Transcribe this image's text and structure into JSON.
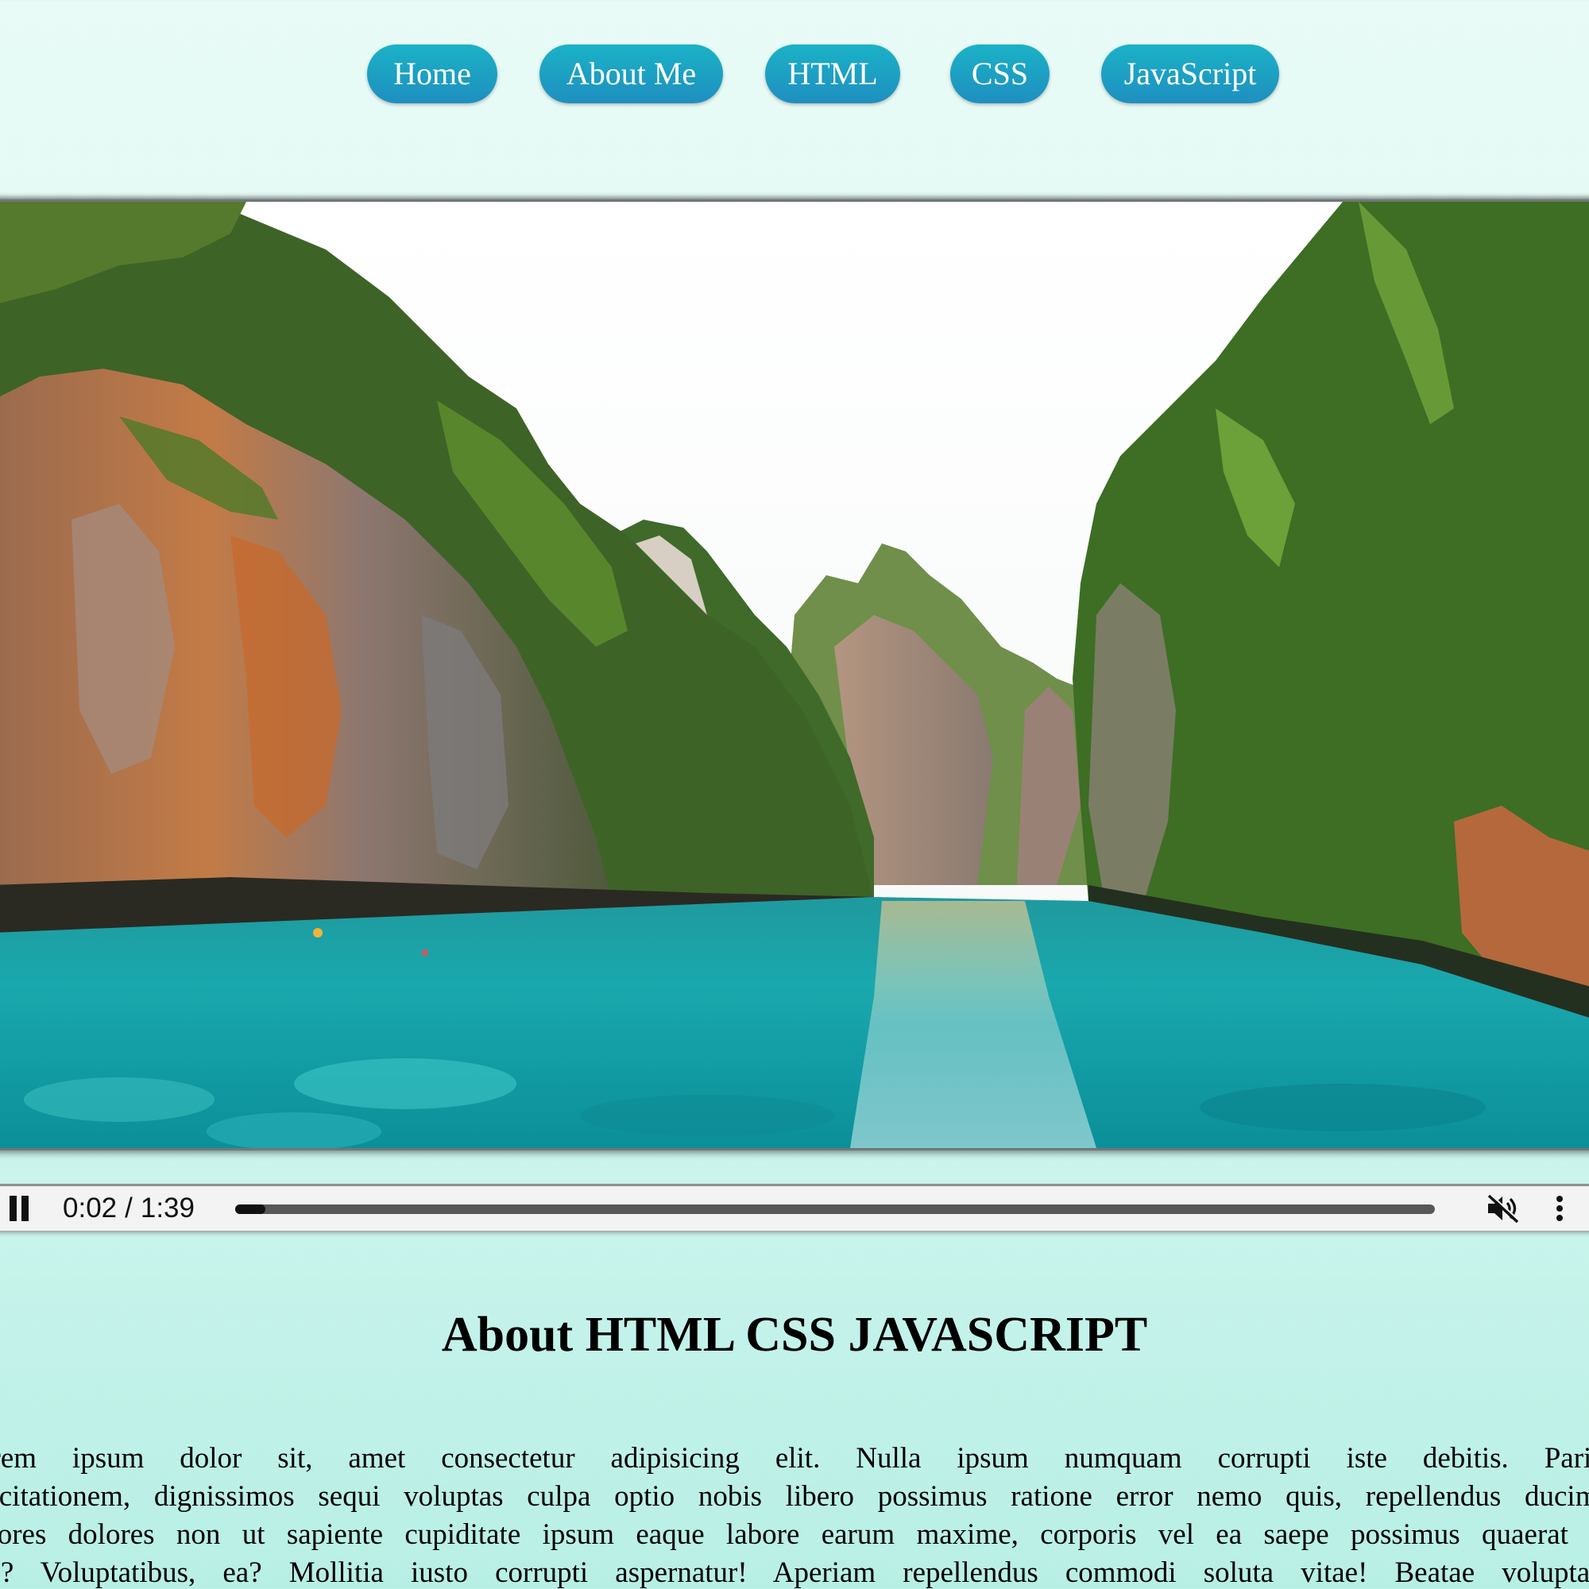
{
  "nav": {
    "items": [
      {
        "label": "Home"
      },
      {
        "label": "About Me"
      },
      {
        "label": "HTML"
      },
      {
        "label": "CSS"
      },
      {
        "label": "JavaScript"
      }
    ]
  },
  "video": {
    "current_time": "0:02",
    "duration": "1:39",
    "time_separator": "/",
    "progress_fraction": 0.02,
    "muted": true,
    "playing": true,
    "icons": {
      "play_state": "pause-icon",
      "volume": "volume-muted-icon",
      "menu": "more-vertical-icon"
    }
  },
  "article": {
    "title": "About HTML CSS JAVASCRIPT",
    "lines": [
      "orem ipsum dolor sit, amet consectetur adipisicing elit. Nulla ipsum numquam corrupti iste debitis. Pariat",
      "ercitationem, dignissimos sequi voluptas culpa optio nobis libero possimus ratione error nemo quis, repellendus ducimu",
      "aiores dolores non ut sapiente cupiditate ipsum eaque labore earum maxime, corporis vel ea saepe possimus quaerat ip",
      "as? Voluptatibus, ea? Mollitia iusto corrupti aspernatur! Aperiam repellendus commodi soluta vitae! Beatae voluptatu"
    ]
  },
  "colors": {
    "nav_button_top": "#1ab2c6",
    "nav_button_bottom": "#1f8fc0",
    "background_top": "#e8fbf6",
    "background_bottom": "#b8efe5"
  }
}
